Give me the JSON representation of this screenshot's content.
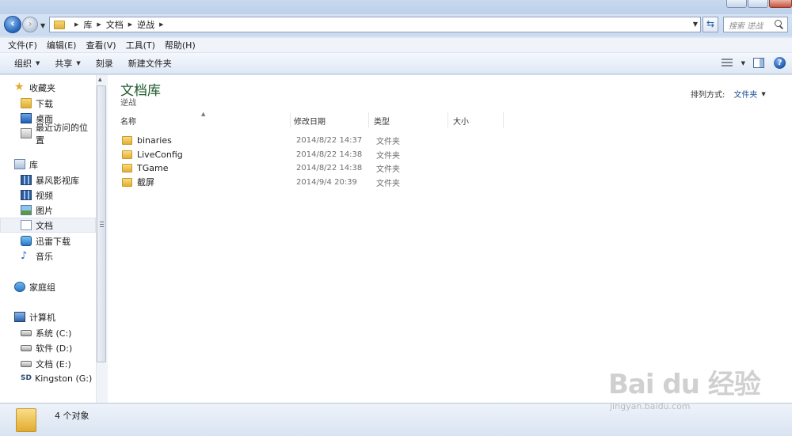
{
  "address": {
    "crumbs": [
      "库",
      "文档",
      "逆战"
    ],
    "search_placeholder": "搜索 逆战"
  },
  "menu": [
    "文件(F)",
    "编辑(E)",
    "查看(V)",
    "工具(T)",
    "帮助(H)"
  ],
  "toolbar": {
    "organize": "组织",
    "share": "共享",
    "burn": "刻录",
    "new_folder": "新建文件夹",
    "help": "?"
  },
  "nav": {
    "favorites": "收藏夹",
    "downloads": "下载",
    "desktop": "桌面",
    "recent": "最近访问的位置",
    "libraries": "库",
    "baofeng": "暴风影视库",
    "videos": "视频",
    "pictures": "图片",
    "documents": "文档",
    "thunder": "迅雷下载",
    "music": "音乐",
    "homegroup": "家庭组",
    "computer": "计算机",
    "drive_c": "系统 (C:)",
    "drive_d": "软件 (D:)",
    "drive_e": "文档 (E:)",
    "drive_g": "Kingston (G:)"
  },
  "main": {
    "title": "文档库",
    "subtitle": "逆战",
    "arrange_label": "排列方式:",
    "arrange_value": "文件夹",
    "columns": {
      "name": "名称",
      "modified": "修改日期",
      "type": "类型",
      "size": "大小"
    },
    "rows": [
      {
        "name": "binaries",
        "date": "2014/8/22 14:37",
        "type": "文件夹"
      },
      {
        "name": "LiveConfig",
        "date": "2014/8/22 14:38",
        "type": "文件夹"
      },
      {
        "name": "TGame",
        "date": "2014/8/22 14:38",
        "type": "文件夹"
      },
      {
        "name": "截屏",
        "date": "2014/9/4 20:39",
        "type": "文件夹"
      }
    ]
  },
  "status": {
    "count": "4 个对象"
  },
  "watermark": {
    "main": "Bai du 经验",
    "sub": "jingyan.baidu.com"
  }
}
